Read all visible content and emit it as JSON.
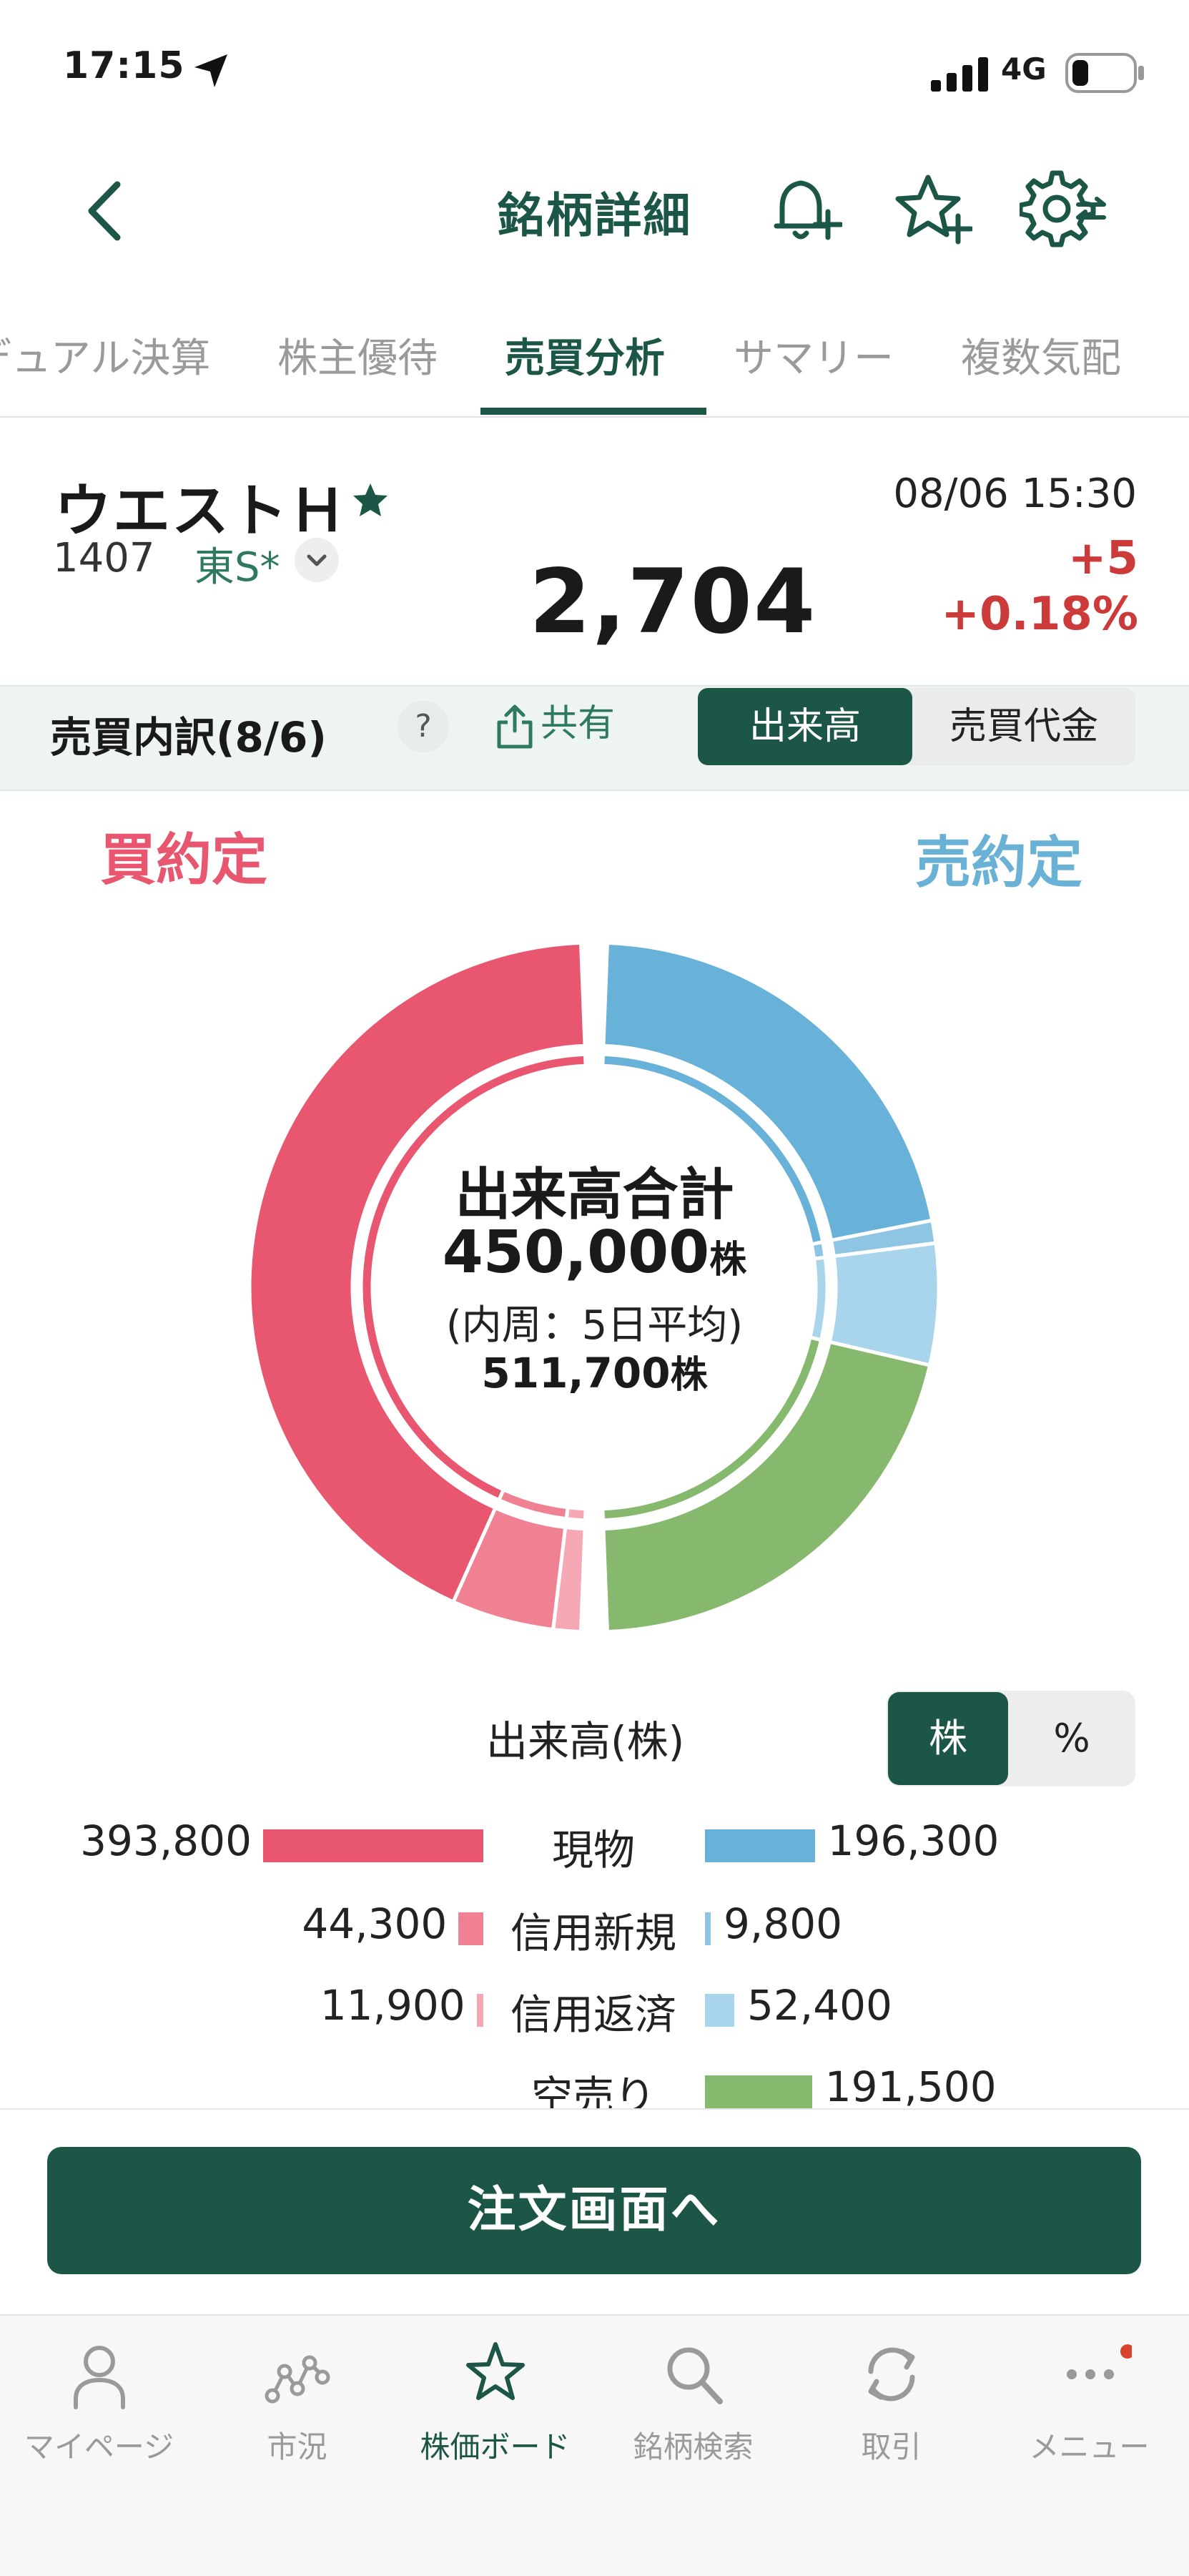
{
  "status_bar": {
    "time": "17:15",
    "network": "4G"
  },
  "nav": {
    "title": "銘柄詳細"
  },
  "tabs": [
    {
      "label": "デュアル決算"
    },
    {
      "label": "株主優待"
    },
    {
      "label": "売買分析",
      "active": true
    },
    {
      "label": "サマリー"
    },
    {
      "label": "複数気配"
    }
  ],
  "stock": {
    "name": "ウエストＨ",
    "code": "1407",
    "market": "東S*",
    "datetime": "08/06 15:30",
    "price": "2,704",
    "change": "+5",
    "change_pct": "+0.18%"
  },
  "breakdown": {
    "title": "売買内訳(8/6)",
    "help": "?",
    "share": "共有",
    "toggle": [
      "出来高",
      "売買代金"
    ],
    "selected": "出来高"
  },
  "donut": {
    "buy_heading": "買約定",
    "sell_heading": "売約定",
    "center_title": "出来高合計",
    "total": "450,000",
    "total_unit": "株",
    "avg_label": "(内周：5日平均)",
    "avg": "511,700",
    "avg_unit": "株"
  },
  "volume_legend": {
    "label": "出来高(株)",
    "unit_toggle": [
      "株",
      "%"
    ],
    "selected_unit": "株"
  },
  "chart_data": {
    "type": "pie",
    "title": "",
    "categories": [
      "現物",
      "信用新規",
      "信用返済",
      "空売り"
    ],
    "series": [
      {
        "name": "買約定",
        "values": [
          393800,
          44300,
          11900,
          null
        ],
        "display": [
          "393,800",
          "44,300",
          "11,900",
          ""
        ]
      },
      {
        "name": "売約定",
        "values": [
          196300,
          9800,
          52400,
          191500
        ],
        "display": [
          "196,300",
          "9,800",
          "52,400",
          "191,500"
        ]
      }
    ],
    "colors": {
      "buy": [
        "#e8576f",
        "#f08193",
        "#f5a7b4"
      ],
      "sell": [
        "#68b1d8",
        "#8ec5e3",
        "#a9d5ec",
        "#86b86d"
      ]
    }
  },
  "order_button": {
    "label": "注文画面へ"
  },
  "bottom_nav": [
    {
      "label": "マイページ",
      "icon": "person-icon"
    },
    {
      "label": "市況",
      "icon": "market-chart-icon"
    },
    {
      "label": "株価ボード",
      "icon": "star-icon",
      "active": true
    },
    {
      "label": "銘柄検索",
      "icon": "search-icon"
    },
    {
      "label": "取引",
      "icon": "trade-refresh-icon"
    },
    {
      "label": "メニュー",
      "icon": "more-icon",
      "badge": true
    }
  ]
}
